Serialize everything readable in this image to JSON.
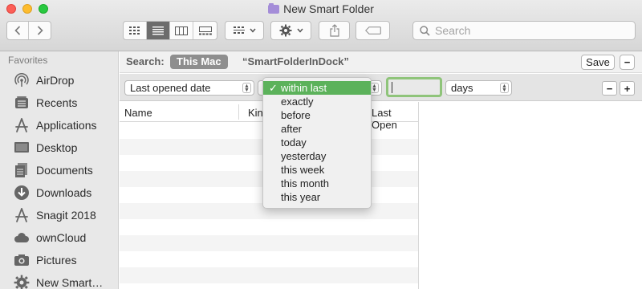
{
  "window": {
    "title": "New Smart Folder"
  },
  "toolbar": {
    "search_placeholder": "Search"
  },
  "sidebar": {
    "heading": "Favorites",
    "items": [
      {
        "label": "AirDrop",
        "icon": "airdrop-icon"
      },
      {
        "label": "Recents",
        "icon": "recents-icon"
      },
      {
        "label": "Applications",
        "icon": "applications-icon"
      },
      {
        "label": "Desktop",
        "icon": "desktop-icon"
      },
      {
        "label": "Documents",
        "icon": "documents-icon"
      },
      {
        "label": "Downloads",
        "icon": "downloads-icon"
      },
      {
        "label": "Snagit 2018",
        "icon": "applications-icon"
      },
      {
        "label": "ownCloud",
        "icon": "cloud-icon"
      },
      {
        "label": "Pictures",
        "icon": "camera-icon"
      },
      {
        "label": "New Smart…",
        "icon": "gear-icon"
      }
    ]
  },
  "searchbar": {
    "label": "Search:",
    "scope_active": "This Mac",
    "scope_other": "“SmartFolderInDock”",
    "save_label": "Save",
    "minus_label": "−"
  },
  "criteria": {
    "attribute": "Last opened date",
    "operator_partial": "i",
    "unit": "days",
    "minus_label": "−",
    "plus_label": "+"
  },
  "columns": {
    "name": "Name",
    "kind": "Kin",
    "last_opened": "Last Open"
  },
  "dropdown": {
    "check": "✓",
    "items": [
      {
        "label": "within last",
        "selected": true
      },
      {
        "label": "exactly",
        "selected": false
      },
      {
        "label": "before",
        "selected": false
      },
      {
        "label": "after",
        "selected": false
      },
      {
        "label": "today",
        "selected": false
      },
      {
        "label": "yesterday",
        "selected": false
      },
      {
        "label": "this week",
        "selected": false
      },
      {
        "label": "this month",
        "selected": false
      },
      {
        "label": "this year",
        "selected": false
      }
    ]
  },
  "colors": {
    "accent_green": "#5cb25b",
    "field_focus": "#8fc47a",
    "scope_bg": "#8e8e8e"
  }
}
